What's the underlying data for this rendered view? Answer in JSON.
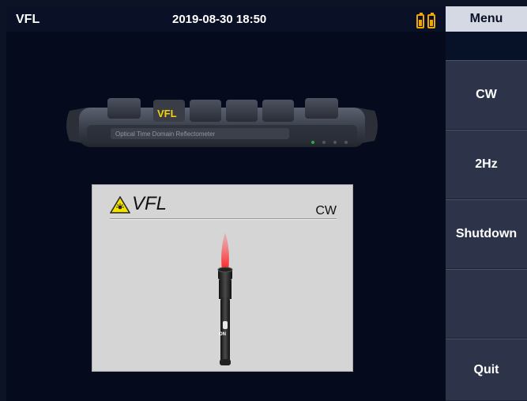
{
  "header": {
    "title": "VFL",
    "datetime": "2019-08-30 18:50",
    "battery_icons": [
      "battery-icon",
      "battery-icon"
    ]
  },
  "device": {
    "tab_label": "VFL",
    "subtitle": "Optical Time Domain Reflectometer"
  },
  "vfl_panel": {
    "title": "VFL",
    "mode": "CW",
    "pen_label": "ON"
  },
  "sidebar": {
    "menu_label": "Menu",
    "keys": [
      {
        "label": "CW"
      },
      {
        "label": "2Hz"
      },
      {
        "label": "Shutdown"
      },
      {
        "label": ""
      },
      {
        "label": "Quit"
      }
    ]
  },
  "colors": {
    "background": "#050b1c",
    "sidebar": "#2b3247",
    "accent": "#f0a800",
    "laser": "#e01010"
  }
}
